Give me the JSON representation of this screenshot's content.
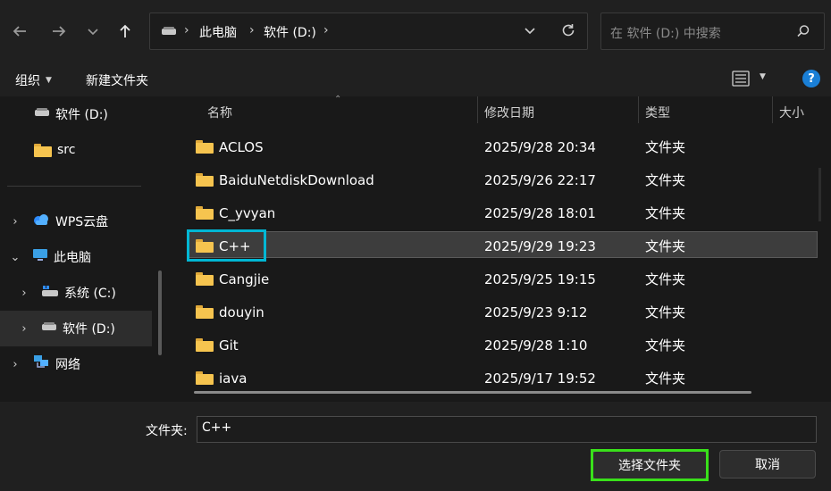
{
  "address": {
    "crumbs": [
      "此电脑",
      "软件 (D:)"
    ],
    "search_placeholder": "在 软件 (D:) 中搜索"
  },
  "toolbar": {
    "organize_label": "组织",
    "new_folder_label": "新建文件夹",
    "help_label": "?"
  },
  "nav": {
    "items": [
      {
        "label": "软件 (D:)",
        "icon": "drive-icon"
      },
      {
        "label": "src",
        "icon": "folder-icon"
      },
      {
        "label": "WPS云盘",
        "icon": "cloud-icon"
      },
      {
        "label": "此电脑",
        "icon": "computer-icon"
      },
      {
        "label": "系统 (C:)",
        "icon": "system-drive-icon"
      },
      {
        "label": "软件 (D:)",
        "icon": "drive-icon"
      },
      {
        "label": "网络",
        "icon": "network-icon"
      }
    ]
  },
  "columns": {
    "name": "名称",
    "modified": "修改日期",
    "type": "类型",
    "size": "大小"
  },
  "files": [
    {
      "name": "ACLOS",
      "modified": "2025/9/28 20:34",
      "type": "文件夹"
    },
    {
      "name": "BaiduNetdiskDownload",
      "modified": "2025/9/26 22:17",
      "type": "文件夹"
    },
    {
      "name": "C_yvyan",
      "modified": "2025/9/28 18:01",
      "type": "文件夹"
    },
    {
      "name": "C++",
      "modified": "2025/9/29 19:23",
      "type": "文件夹"
    },
    {
      "name": "Cangjie",
      "modified": "2025/9/25 19:15",
      "type": "文件夹"
    },
    {
      "name": "douyin",
      "modified": "2025/9/23 9:12",
      "type": "文件夹"
    },
    {
      "name": "Git",
      "modified": "2025/9/28 1:10",
      "type": "文件夹"
    },
    {
      "name": "iava",
      "modified": "2025/9/17 19:52",
      "type": "文件夹"
    }
  ],
  "footer": {
    "folder_label": "文件夹:",
    "folder_value": "C++",
    "select_label": "选择文件夹",
    "cancel_label": "取消"
  },
  "colors": {
    "highlight_cyan": "#00b7d4",
    "highlight_green": "#39e01a",
    "accent_blue": "#1a7fd6"
  }
}
